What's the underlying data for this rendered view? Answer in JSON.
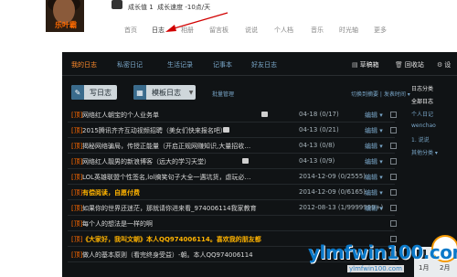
{
  "profile": {
    "name": "乐叶霸",
    "growth_value": "成长值 1",
    "growth_speed": "成长速度 -10点/天"
  },
  "topnav": [
    "首页",
    "日志",
    "相册",
    "留言板",
    "说说",
    "个人档",
    "音乐",
    "时光轴",
    "更多"
  ],
  "tabs": [
    "我的日志",
    "私密日记",
    "生活记录",
    "记事本",
    "好友日志"
  ],
  "tools": {
    "draft": "草稿箱",
    "recycle": "回收站",
    "settings": "设"
  },
  "buttons": {
    "write": "写日志",
    "template": "模板日志",
    "batch": "批量管理"
  },
  "sort": {
    "switch_list": "切换到摘要",
    "sort_by": "发表时间"
  },
  "rows": [
    {
      "tag": "[顶]",
      "title": "网络红人朝宝的个人业务单",
      "pic": true,
      "date": "04-18 (0/17)",
      "edit": "编辑 ▾",
      "hl": false
    },
    {
      "tag": "[顶]",
      "title": "2015腾讯齐齐互动视频招聘（美女们快来报名吧）",
      "pic": true,
      "date": "04-13 (0/21)",
      "edit": "编辑 ▾",
      "hl": false
    },
    {
      "tag": "[顶]",
      "title": "揭秘网络骗局，传授正能量（开启正规网赚知识,大量招收…",
      "pic": false,
      "date": "04-13 (0/8)",
      "edit": "编辑 ▾",
      "hl": false
    },
    {
      "tag": "[顶]",
      "title": "网络红人靓男的新浪博客（远大的学习天堂）",
      "pic": true,
      "date": "04-13 (0/9)",
      "edit": "编辑 ▾",
      "hl": false
    },
    {
      "tag": "[顶]",
      "title": "LOL英雄联盟个性签名,lol搞笑句子大全一遇坑货，虐玩必…",
      "pic": false,
      "date": "2014-12-09 (0/2555)",
      "edit": "编辑 ▾",
      "hl": false
    },
    {
      "tag": "[顶]",
      "title": "有偿阅读，自愿付费",
      "pic": false,
      "date": "2014-12-09 (0/6165)",
      "edit": "编辑 ▾",
      "hl": true
    },
    {
      "tag": "[顶]",
      "title": "如果你的世界还迷茫，那就请你进来看_974006114我家教育",
      "pic": false,
      "date": "2012-08-13 (1/9999999+)",
      "edit": "编辑 ▾",
      "hl": false
    },
    {
      "tag": "[顶]",
      "title": "每个人的想法是一样的啊",
      "pic": false,
      "date": "",
      "edit": "",
      "hl": false
    },
    {
      "tag": "[顶]",
      "title": "《大家好，我叫文朝》本人QQ974006114。喜欢我的朋友都",
      "pic": false,
      "date": "",
      "edit": "",
      "hl": true
    },
    {
      "tag": "[顶]",
      "title": "做人的基本原则（看完终身受益）-朝。本人QQ974006114",
      "pic": false,
      "date": "",
      "edit": "",
      "hl": false
    }
  ],
  "sidebar": {
    "header": "日志分类",
    "items": [
      "全部日志",
      "个人日记",
      "wenchao",
      "1. 说说",
      "其他分类 ▾"
    ]
  },
  "calendar": {
    "months": [
      "1月",
      "2月"
    ],
    "prev": "‹",
    "next": "›"
  },
  "watermark": {
    "text": "ylmfwin100.com",
    "sub": "ylmfwin100.com"
  }
}
